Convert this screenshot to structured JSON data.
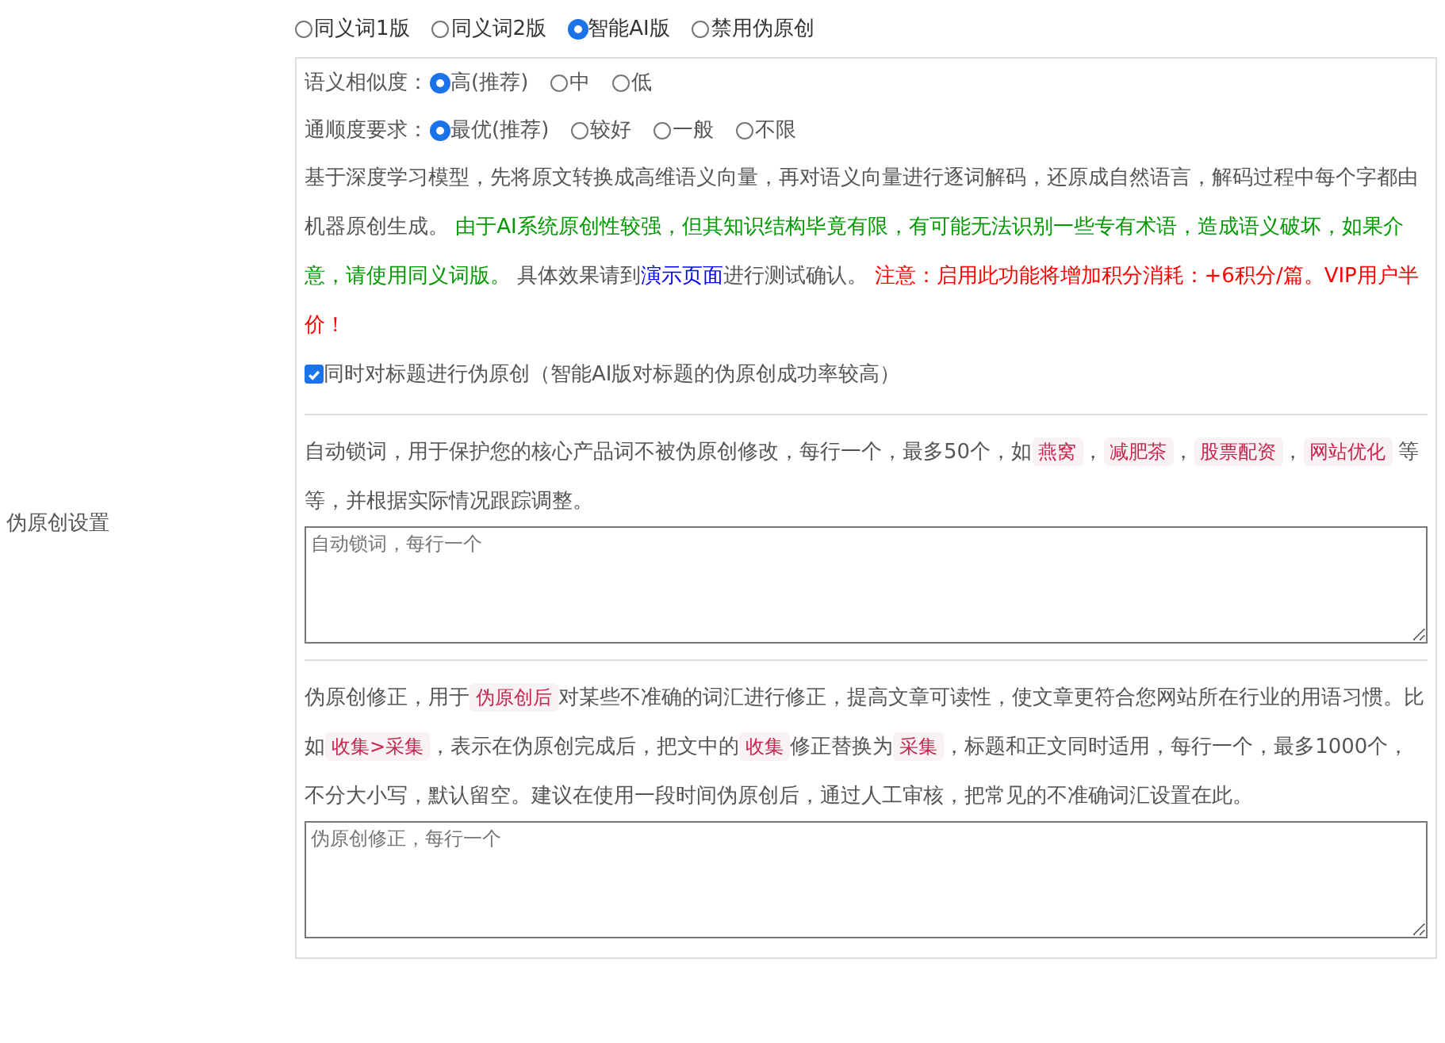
{
  "side_label": "伪原创设置",
  "modes": [
    {
      "label": "同义词1版",
      "selected": false
    },
    {
      "label": "同义词2版",
      "selected": false
    },
    {
      "label": "智能AI版",
      "selected": true
    },
    {
      "label": "禁用伪原创",
      "selected": false
    }
  ],
  "option_groups": [
    {
      "label": "语义相似度：",
      "options": [
        {
          "label": "高(推荐)",
          "selected": true
        },
        {
          "label": "中",
          "selected": false
        },
        {
          "label": "低",
          "selected": false
        }
      ]
    },
    {
      "label": "通顺度要求：",
      "options": [
        {
          "label": "最优(推荐)",
          "selected": true
        },
        {
          "label": "较好",
          "selected": false
        },
        {
          "label": "一般",
          "selected": false
        },
        {
          "label": "不限",
          "selected": false
        }
      ]
    }
  ],
  "ai_description": [
    {
      "kind": "text",
      "text": "基于深度学习模型，先将原文转换成高维语义向量，再对语义向量进行逐词解码，还原成自然语言，解码过程中每个字都由机器原创生成。 "
    },
    {
      "kind": "green",
      "text": "由于AI系统原创性较强，但其知识结构毕竟有限，有可能无法识别一些专有术语，造成语义破坏，如果介意，请使用同义词版。"
    },
    {
      "kind": "text",
      "text": " 具体效果请到"
    },
    {
      "kind": "link",
      "text": "演示页面"
    },
    {
      "kind": "text",
      "text": "进行测试确认。 "
    },
    {
      "kind": "red",
      "text": "注意：启用此功能将增加积分消耗：+6积分/篇。VIP用户半价！"
    }
  ],
  "title_option": {
    "label": "同时对标题进行伪原创（智能AI版对标题的伪原创成功率较高）",
    "checked": true
  },
  "lock_words": {
    "description": [
      {
        "kind": "text",
        "text": "自动锁词，用于保护您的核心产品词不被伪原创修改，每行一个，最多50个，如"
      },
      {
        "kind": "code",
        "text": "燕窝"
      },
      {
        "kind": "text",
        "text": "，"
      },
      {
        "kind": "code",
        "text": "减肥茶"
      },
      {
        "kind": "text",
        "text": "，"
      },
      {
        "kind": "code",
        "text": "股票配资"
      },
      {
        "kind": "text",
        "text": "，"
      },
      {
        "kind": "code",
        "text": "网站优化"
      },
      {
        "kind": "text",
        "text": " 等等，并根据实际情况跟踪调整。"
      }
    ],
    "placeholder": "自动锁词，每行一个"
  },
  "corrections": {
    "description": [
      {
        "kind": "text",
        "text": "伪原创修正，用于"
      },
      {
        "kind": "code",
        "text": "伪原创后"
      },
      {
        "kind": "text",
        "text": "对某些不准确的词汇进行修正，提高文章可读性，使文章更符合您网站所在行业的用语习惯。比如"
      },
      {
        "kind": "code",
        "text": "收集>采集"
      },
      {
        "kind": "text",
        "text": "，表示在伪原创完成后，把文中的"
      },
      {
        "kind": "code",
        "text": "收集"
      },
      {
        "kind": "text",
        "text": "修正替换为"
      },
      {
        "kind": "code",
        "text": "采集"
      },
      {
        "kind": "text",
        "text": "，标题和正文同时适用，每行一个，最多1000个，不分大小写，默认留空。建议在使用一段时间伪原创后，通过人工审核，把常见的不准确词汇设置在此。"
      }
    ],
    "placeholder": "伪原创修正，每行一个"
  }
}
